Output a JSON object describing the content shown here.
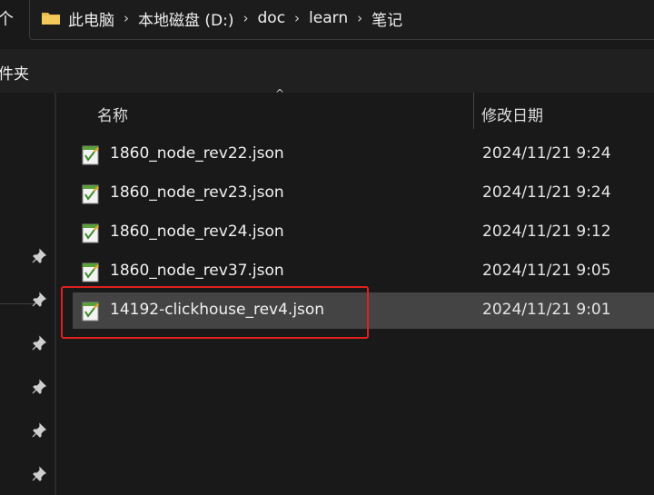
{
  "nav": {
    "partial_glyph": "个"
  },
  "address_bar": {
    "breadcrumbs": [
      "此电脑",
      "本地磁盘 (D:)",
      "doc",
      "learn",
      "笔记"
    ],
    "separator": "›"
  },
  "toolbar": {
    "partial_label": "件夹"
  },
  "file_list": {
    "columns": {
      "name": "名称",
      "date": "修改日期"
    },
    "sort_indicator": "^",
    "files": [
      {
        "name": "1860_node_rev22.json",
        "date": "2024/11/21 9:24"
      },
      {
        "name": "1860_node_rev23.json",
        "date": "2024/11/21 9:24"
      },
      {
        "name": "1860_node_rev24.json",
        "date": "2024/11/21 9:12"
      },
      {
        "name": "1860_node_rev37.json",
        "date": "2024/11/21 9:05"
      },
      {
        "name": "14192-clickhouse_rev4.json",
        "date": "2024/11/21 9:01",
        "selected": true
      }
    ]
  },
  "icons": {
    "folder": "folder-icon",
    "file": "json-file-icon",
    "pin": "pin-icon"
  },
  "colors": {
    "background": "#191919",
    "toolbar": "#202020",
    "selected_row": "#444444",
    "highlight_border": "#e0201c",
    "folder": "#e8b84a"
  }
}
